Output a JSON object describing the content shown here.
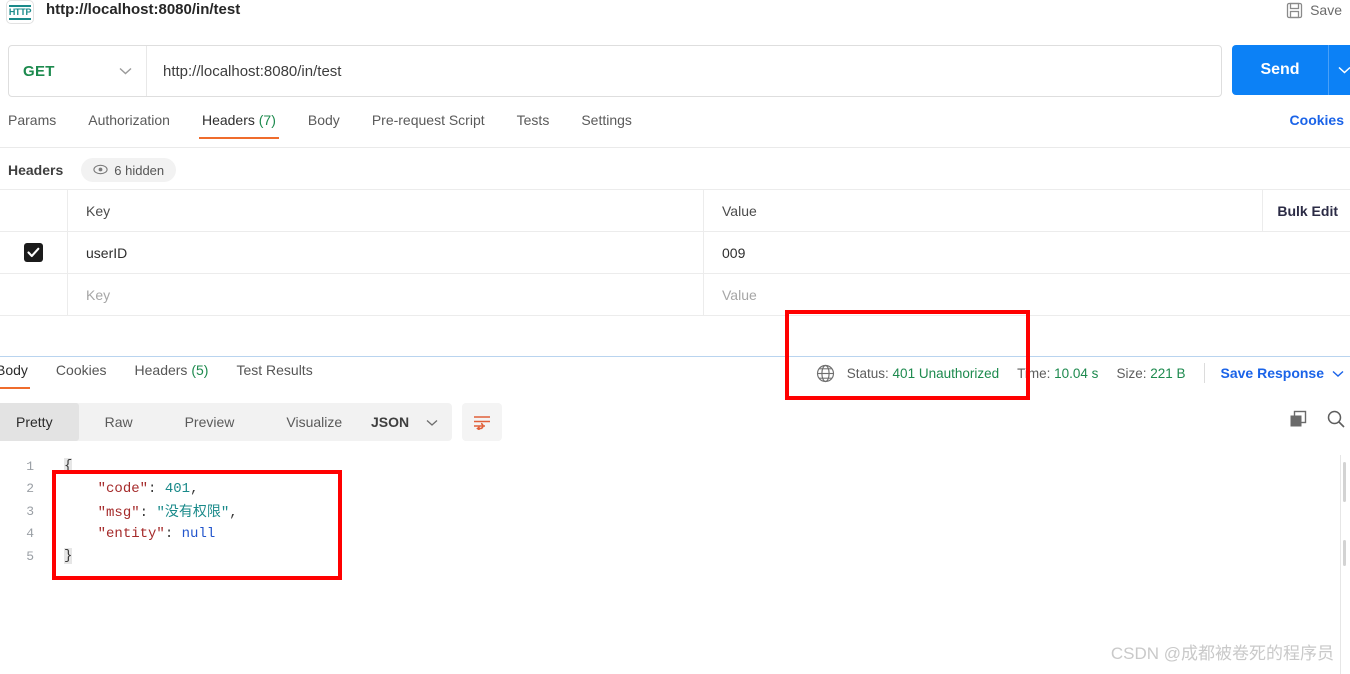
{
  "window": {
    "tab_title": "http://localhost:8080/in/test",
    "protocol_badge": "HTTP",
    "save_label": "Save",
    "save_icon": "floppy-disk-icon"
  },
  "request": {
    "method": "GET",
    "method_caret": "chevron-down-icon",
    "url": "http://localhost:8080/in/test",
    "send_label": "Send",
    "send_caret": "chevron-down-icon",
    "tabs": [
      {
        "label": "Params",
        "count": "",
        "active": false
      },
      {
        "label": "Authorization",
        "count": "",
        "active": false
      },
      {
        "label": "Headers",
        "count": "(7)",
        "active": true
      },
      {
        "label": "Body",
        "count": "",
        "active": false
      },
      {
        "label": "Pre-request Script",
        "count": "",
        "active": false
      },
      {
        "label": "Tests",
        "count": "",
        "active": false
      },
      {
        "label": "Settings",
        "count": "",
        "active": false
      }
    ],
    "cookies_link": "Cookies"
  },
  "headers_panel": {
    "title": "Headers",
    "hidden_badge": "6 hidden",
    "hidden_icon": "eye-icon",
    "bulk_edit": "Bulk Edit",
    "columns": {
      "key": "Key",
      "value": "Value"
    },
    "rows": [
      {
        "checked": true,
        "key": "userID",
        "value": "009",
        "placeholder": false
      },
      {
        "checked": false,
        "key": "Key",
        "value": "Value",
        "placeholder": true
      }
    ]
  },
  "response": {
    "tabs": [
      {
        "label": "Body",
        "count": "",
        "active": true
      },
      {
        "label": "Cookies",
        "count": "",
        "active": false
      },
      {
        "label": "Headers",
        "count": "(5)",
        "active": false
      },
      {
        "label": "Test Results",
        "count": "",
        "active": false
      }
    ],
    "meta": {
      "globe_icon": "globe-icon",
      "status_label": "Status:",
      "status_value": "401 Unauthorized",
      "time_label": "Time:",
      "time_value": "10.04 s",
      "size_label": "Size:",
      "size_value": "221 B",
      "save_response": "Save Response",
      "save_response_caret": "chevron-down-icon"
    },
    "toolbar": {
      "views": [
        {
          "label": "Pretty",
          "active": true
        },
        {
          "label": "Raw",
          "active": false
        },
        {
          "label": "Preview",
          "active": false
        },
        {
          "label": "Visualize",
          "active": false
        }
      ],
      "language": "JSON",
      "language_caret": "chevron-down-icon",
      "wrap_icon": "word-wrap-icon",
      "copy_icon": "copy-icon",
      "search_icon": "search-icon"
    },
    "body": {
      "language": "json",
      "line_numbers": [
        "1",
        "2",
        "3",
        "4",
        "5"
      ],
      "lines": [
        {
          "n": "1",
          "tokens": [
            {
              "t": "{",
              "c": "brace"
            }
          ]
        },
        {
          "n": "2",
          "tokens": [
            {
              "t": "    ",
              "c": "plain"
            },
            {
              "t": "\"code\"",
              "c": "key"
            },
            {
              "t": ": ",
              "c": "punct"
            },
            {
              "t": "401",
              "c": "num"
            },
            {
              "t": ",",
              "c": "punct"
            }
          ]
        },
        {
          "n": "3",
          "tokens": [
            {
              "t": "    ",
              "c": "plain"
            },
            {
              "t": "\"msg\"",
              "c": "key"
            },
            {
              "t": ": ",
              "c": "punct"
            },
            {
              "t": "\"没有权限\"",
              "c": "str"
            },
            {
              "t": ",",
              "c": "punct"
            }
          ]
        },
        {
          "n": "4",
          "tokens": [
            {
              "t": "    ",
              "c": "plain"
            },
            {
              "t": "\"entity\"",
              "c": "key"
            },
            {
              "t": ": ",
              "c": "punct"
            },
            {
              "t": "null",
              "c": "null"
            }
          ]
        },
        {
          "n": "5",
          "tokens": [
            {
              "t": "}",
              "c": "brace"
            }
          ]
        }
      ],
      "raw": "{\n    \"code\": 401,\n    \"msg\": \"没有权限\",\n    \"entity\": null\n}"
    }
  },
  "annotations": [
    {
      "name": "status-highlight",
      "color": "#ff0000"
    },
    {
      "name": "json-body-highlight",
      "color": "#ff0000"
    }
  ],
  "watermark": "CSDN @成都被卷死的程序员"
}
